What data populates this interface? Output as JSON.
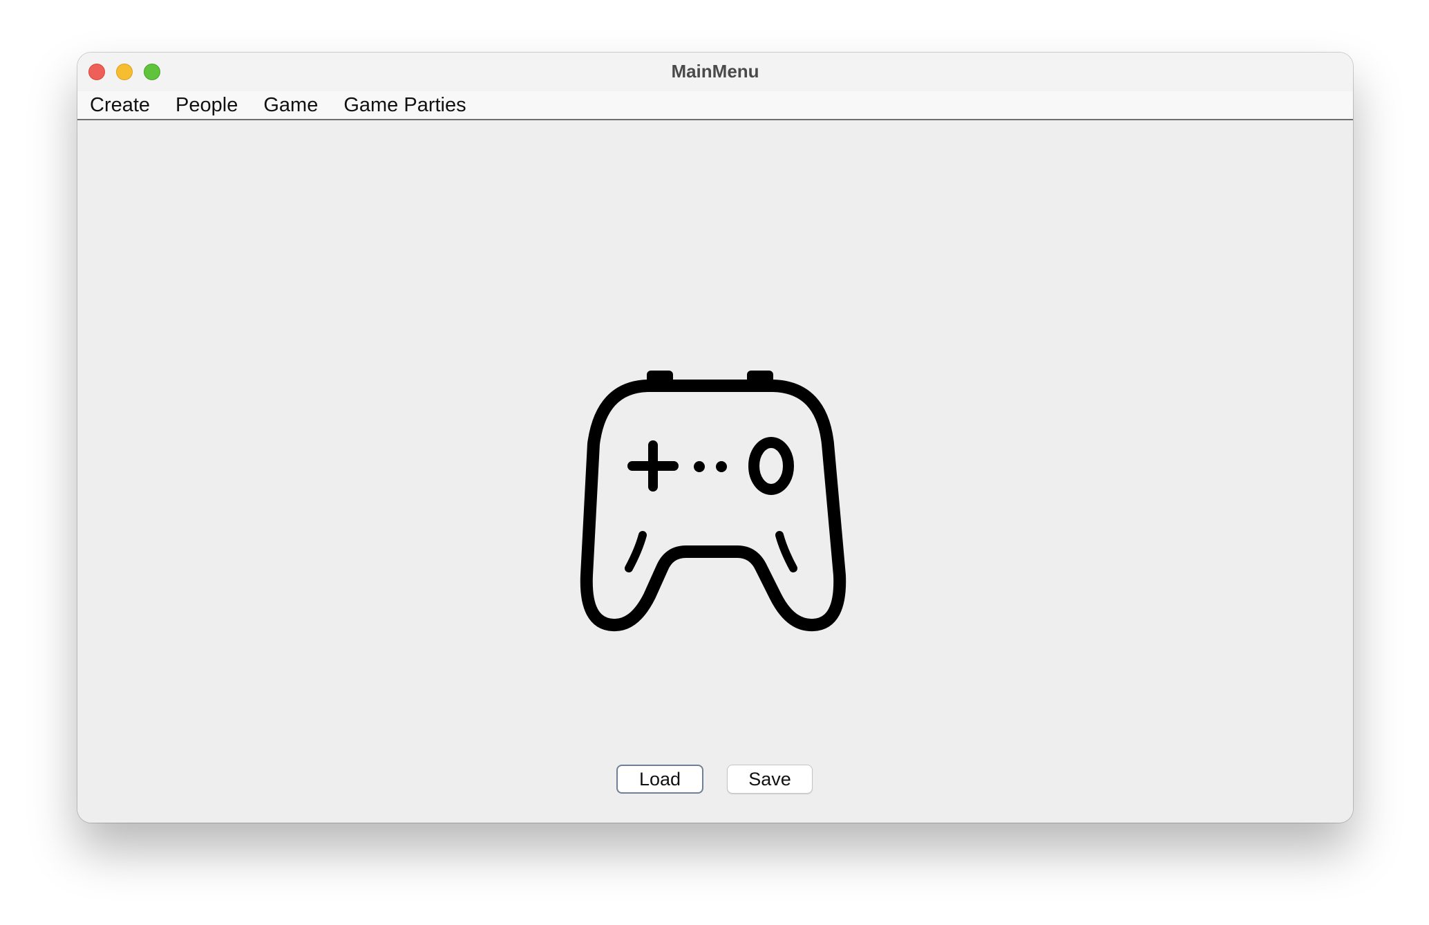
{
  "window": {
    "title": "MainMenu"
  },
  "menubar": {
    "items": [
      {
        "label": "Create"
      },
      {
        "label": "People"
      },
      {
        "label": "Game"
      },
      {
        "label": "Game Parties"
      }
    ]
  },
  "main": {
    "icon": "game-controller-icon"
  },
  "buttons": {
    "load_label": "Load",
    "save_label": "Save"
  },
  "colors": {
    "close": "#ee5f57",
    "minimize": "#f5bd2f",
    "maximize": "#5fc43c",
    "focus_border": "#6f7f94"
  }
}
